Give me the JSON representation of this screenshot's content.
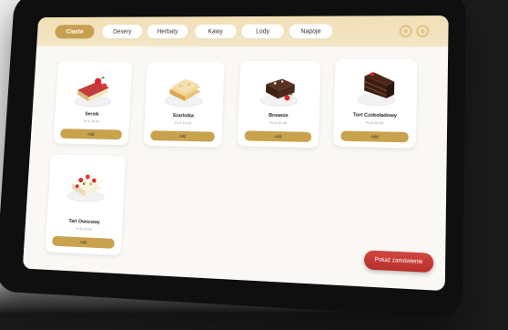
{
  "tabs": [
    {
      "label": "Ciasta",
      "active": true
    },
    {
      "label": "Desery",
      "active": false
    },
    {
      "label": "Herbaty",
      "active": false
    },
    {
      "label": "Kawy",
      "active": false
    },
    {
      "label": "Lody",
      "active": false
    },
    {
      "label": "Napoje",
      "active": false
    }
  ],
  "products": [
    {
      "name": "Sernik",
      "price": "PLN 16.99",
      "add_label": "Add",
      "icon": "cheesecake-icon"
    },
    {
      "name": "Szarlotka",
      "price": "PLN 13.00",
      "add_label": "Add",
      "icon": "apple-pie-icon"
    },
    {
      "name": "Brownie",
      "price": "PLN 12.50",
      "add_label": "Add",
      "icon": "brownie-icon"
    },
    {
      "name": "Tort Czekoladowy",
      "price": "PLN 18.99",
      "add_label": "Add",
      "icon": "chocolate-cake-icon"
    },
    {
      "name": "Tart Owocowy",
      "price": "PLN 15.00",
      "add_label": "Add",
      "icon": "fruit-tart-icon"
    }
  ],
  "order_button": {
    "label": "Pokaż zamówienie"
  },
  "colors": {
    "accent": "#c6a04f",
    "tabbar": "#f1dfb6",
    "order": "#c23a35"
  }
}
